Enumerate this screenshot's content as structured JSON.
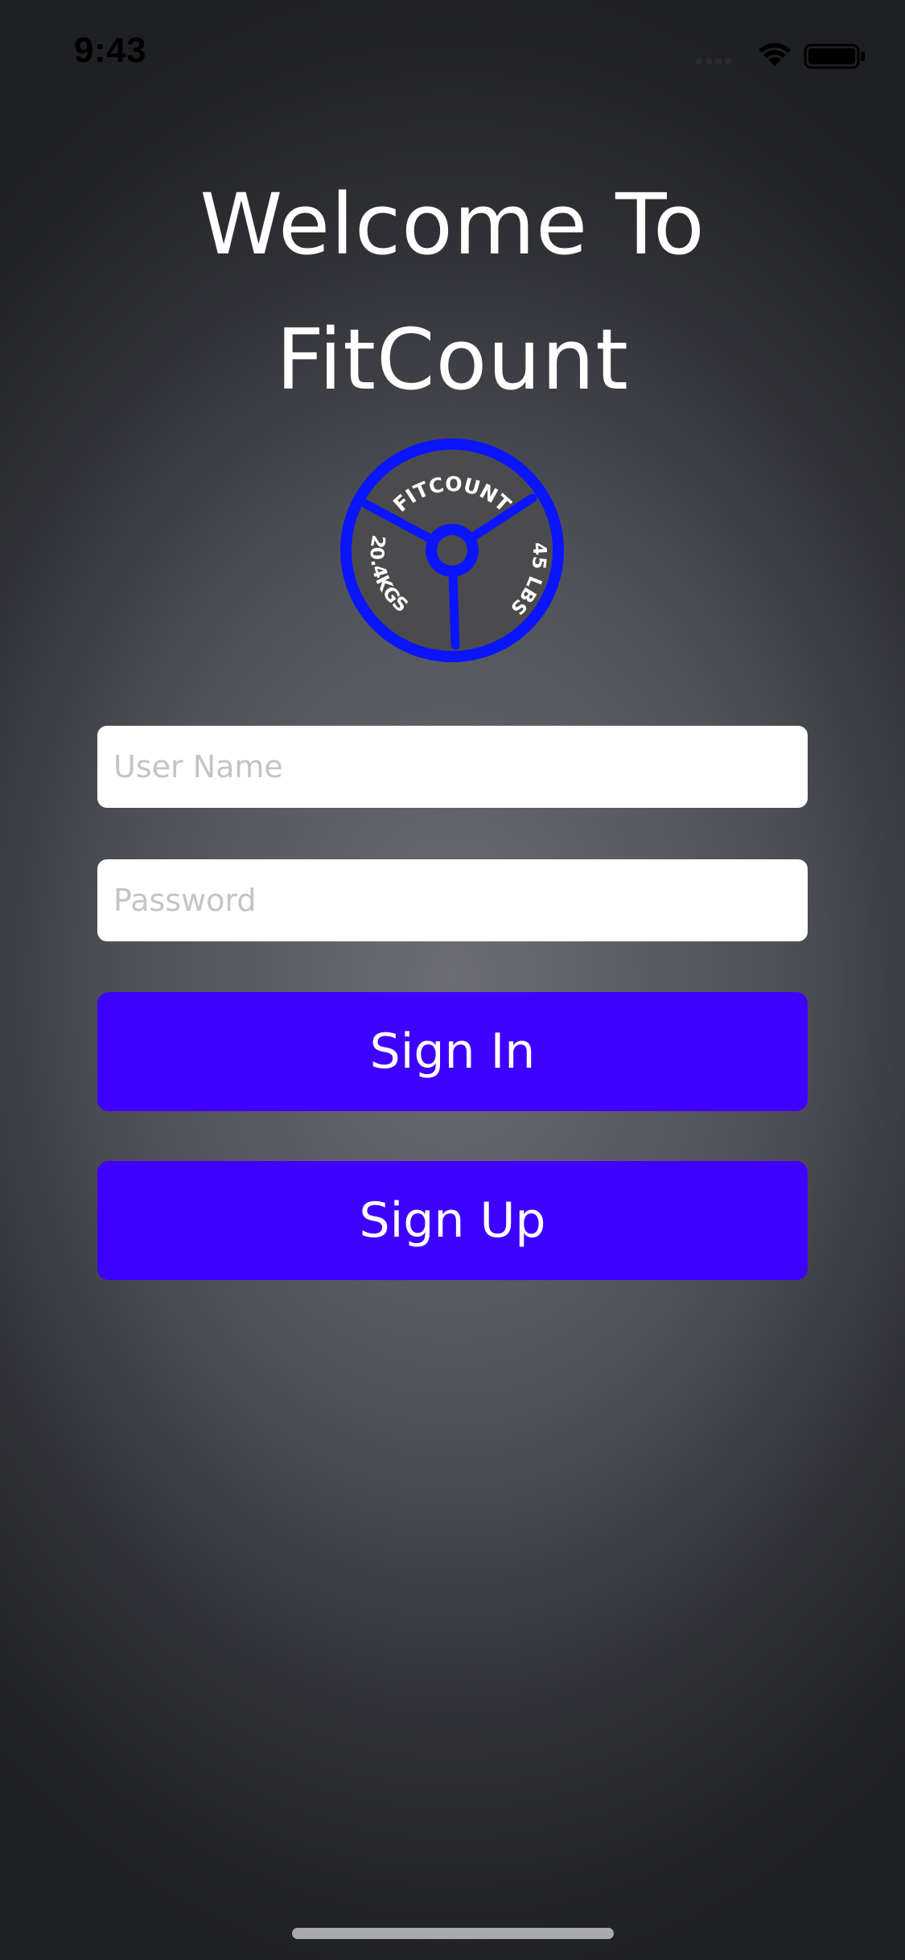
{
  "status_bar": {
    "time": "9:43",
    "icons": [
      "cellular-signal-icon",
      "wifi-icon",
      "battery-icon"
    ]
  },
  "welcome": {
    "line1": "Welcome To",
    "line2": "FitCount"
  },
  "logo": {
    "icon": "weight-plate-logo-icon",
    "top_text": "FITCOUNT",
    "left_text": "20.4KGS",
    "right_text": "45 LBS",
    "ring_color": "#0a14ff",
    "plate_color": "#4b4b4e"
  },
  "form": {
    "username_placeholder": "User Name",
    "username_value": "",
    "password_placeholder": "Password",
    "password_value": "",
    "sign_in_label": "Sign In",
    "sign_up_label": "Sign Up"
  },
  "colors": {
    "button_bg": "#3e00ff",
    "text": "#ffffff",
    "background_center": "#6d6e74",
    "background_edge": "#1f2023"
  }
}
